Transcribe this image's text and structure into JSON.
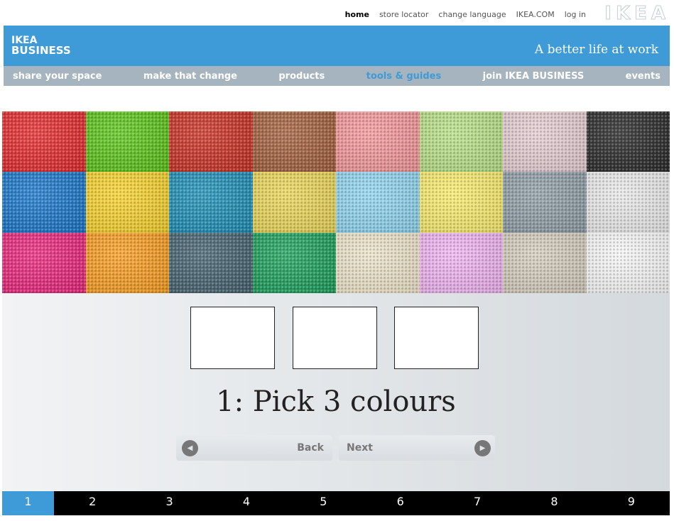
{
  "top_links": [
    {
      "label": "home",
      "active": true
    },
    {
      "label": "store locator",
      "active": false
    },
    {
      "label": "change language",
      "active": false
    },
    {
      "label": "IKEA.COM",
      "active": false
    },
    {
      "label": "log in",
      "active": false
    }
  ],
  "logo_text": "IKEA",
  "brand": {
    "line1": "IKEA",
    "line2": "BUSINESS"
  },
  "tagline": "A better life at work",
  "nav": [
    {
      "label": "share your space",
      "active": false
    },
    {
      "label": "make that change",
      "active": false
    },
    {
      "label": "products",
      "active": false
    },
    {
      "label": "tools & guides",
      "active": true
    },
    {
      "label": "join IKEA BUSINESS",
      "active": false
    },
    {
      "label": "events",
      "active": false
    }
  ],
  "swatches": [
    "#e32c2e",
    "#5cc41a",
    "#c93226",
    "#a3603e",
    "#f3979a",
    "#b7df86",
    "#e4ccd0",
    "#2b2b2b",
    "#1b77c9",
    "#f5d12d",
    "#1f8fb6",
    "#e9d558",
    "#8fd4ee",
    "#f7ea6c",
    "#8f9ea6",
    "#e8e8e8",
    "#e8287c",
    "#f79d22",
    "#46636f",
    "#1ea05c",
    "#ebe2c7",
    "#eeb3ef",
    "#d3cbbb",
    "#f5f5f5"
  ],
  "selection_slots": [
    "",
    "",
    ""
  ],
  "step_title": "1: Pick 3 colours",
  "back_label": "Back",
  "next_label": "Next",
  "steps": [
    "1",
    "2",
    "3",
    "4",
    "5",
    "6",
    "7",
    "8",
    "9"
  ],
  "active_step": "1",
  "colors": {
    "accent": "#3e9bd7",
    "nav": "#a6b4bf"
  }
}
